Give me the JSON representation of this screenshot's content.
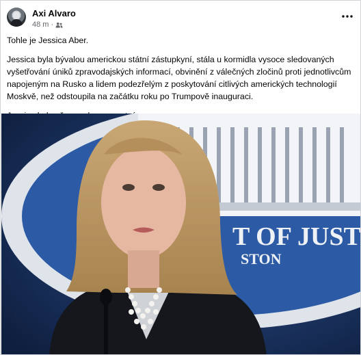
{
  "post": {
    "author": "Axi Alvaro",
    "time": "48 m",
    "audience_icon": "friends-icon",
    "menu_icon": "more-horizontal-icon",
    "paragraphs": [
      "Tohle je Jessica Aber.",
      "Jessica byla bývalou americkou státní zástupkyní, stála u kormidla vysoce sledovaných vyšetřování úniků zpravodajských informací, obvinění z válečných zločinů proti jednotlivcům napojeným na Rusko a lidem podezřelým z poskytování citlivých amerických technologií Moskvě, než odstoupila na začátku roku po Trumpově inauguraci.",
      "Jessica byla včera nalezena mrtvá."
    ]
  },
  "photo": {
    "seal_text": "T OF JUSTIC",
    "seal_subtext": "STON"
  },
  "colors": {
    "text": "#050505",
    "secondary": "#65676b",
    "background": "#ffffff",
    "photo_backdrop": "#1d3766"
  }
}
